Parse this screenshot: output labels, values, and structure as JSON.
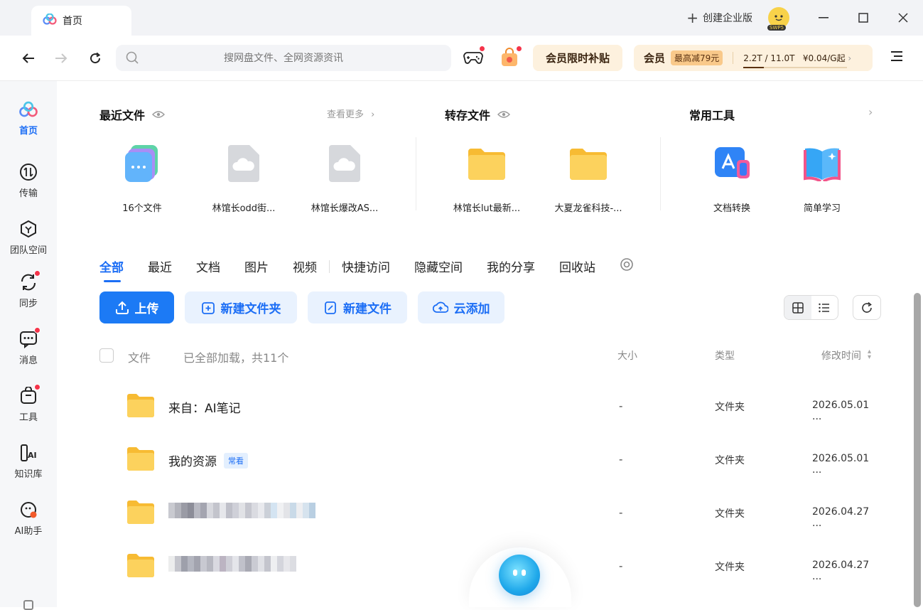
{
  "window": {
    "tab_label": "首页",
    "enterprise_label": "创建企业版",
    "avatar_badge": "SWP5"
  },
  "toolbar": {
    "search_placeholder": "搜网盘文件、全网资源资讯",
    "promo_limited": "会员限时补贴",
    "vip_label": "会员",
    "vip_discount": "最高减79元",
    "quota_text": "2.2T / 11.0T",
    "quota_used_fraction": 0.2,
    "price_text": "¥0.04/G起"
  },
  "sidebar": {
    "items": [
      {
        "label": "首页",
        "icon": "home-logo-icon",
        "active": true
      },
      {
        "label": "传输",
        "icon": "transfer-icon",
        "active": false
      },
      {
        "label": "团队空间",
        "icon": "team-space-icon",
        "active": false
      },
      {
        "label": "同步",
        "icon": "sync-icon",
        "active": false,
        "dot": true
      },
      {
        "label": "消息",
        "icon": "message-icon",
        "active": false,
        "dot": true
      },
      {
        "label": "工具",
        "icon": "tools-icon",
        "active": false,
        "dot": true
      },
      {
        "label": "知识库",
        "icon": "knowledge-base-icon",
        "active": false
      },
      {
        "label": "AI助手",
        "icon": "ai-assistant-icon",
        "active": false
      }
    ]
  },
  "recent": {
    "title": "最近文件",
    "more": "查看更多",
    "files": [
      {
        "name": "16个文件",
        "icon": "file-stack-icon"
      },
      {
        "name": "林馆长odd街...",
        "icon": "cloud-file-icon"
      },
      {
        "name": "林馆长爆改AS...",
        "icon": "cloud-file-icon"
      }
    ]
  },
  "transfer": {
    "title": "转存文件",
    "files": [
      {
        "name": "林馆长lut最新...",
        "icon": "folder-icon"
      },
      {
        "name": "大夏龙雀科技-...",
        "icon": "folder-icon"
      }
    ]
  },
  "tools": {
    "title": "常用工具",
    "items": [
      {
        "name": "文档转换",
        "icon": "doc-convert-icon"
      },
      {
        "name": "简单学习",
        "icon": "book-icon"
      }
    ]
  },
  "filetabs": [
    "全部",
    "最近",
    "文档",
    "图片",
    "视频",
    "快捷访问",
    "隐藏空间",
    "我的分享",
    "回收站"
  ],
  "actions": {
    "upload": "上传",
    "new_folder": "新建文件夹",
    "new_file": "新建文件",
    "cloud_add": "云添加"
  },
  "table": {
    "col_file": "文件",
    "loaded_status": "已全部加载，共11个",
    "col_size": "大小",
    "col_type": "类型",
    "col_modified": "修改时间",
    "rows": [
      {
        "name": "来自：AI笔记",
        "tag": "",
        "size": "-",
        "type": "文件夹",
        "modified": "2026.05.01 ...",
        "blurred": false
      },
      {
        "name": "我的资源",
        "tag": "常看",
        "size": "-",
        "type": "文件夹",
        "modified": "2026.05.01 ...",
        "blurred": false
      },
      {
        "name": "",
        "tag": "",
        "size": "-",
        "type": "文件夹",
        "modified": "2026.04.27 ...",
        "blurred": true
      },
      {
        "name": "",
        "tag": "",
        "size": "-",
        "type": "文件夹",
        "modified": "2026.04.27 ...",
        "blurred": true
      }
    ]
  },
  "colors": {
    "accent": "#1c7af5",
    "accent_light": "#e9f2fe",
    "promo_bg": "#fdf1de",
    "sidebar_bg": "#f6f7f9",
    "folder": "#fbcb4f",
    "red_dot": "#f5344a"
  }
}
